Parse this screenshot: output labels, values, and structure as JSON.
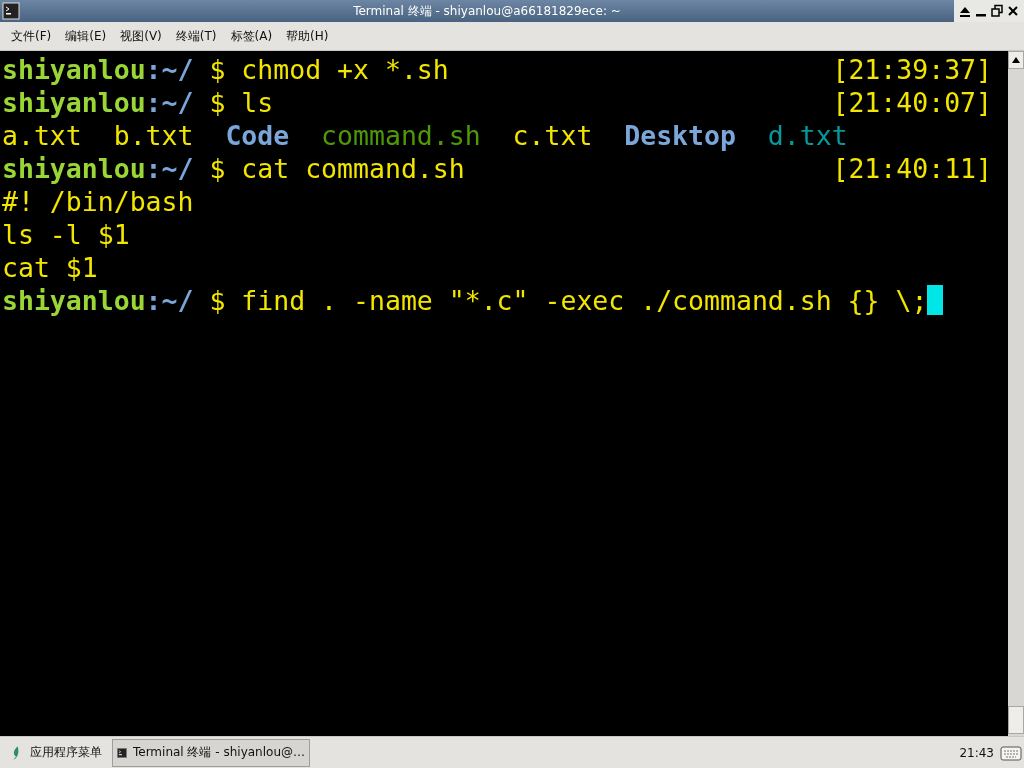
{
  "window": {
    "title": "Terminal 终端 - shiyanlou@a66181829ece: ~"
  },
  "menu": [
    "文件(F)",
    "编辑(E)",
    "视图(V)",
    "终端(T)",
    "标签(A)",
    "帮助(H)"
  ],
  "terminal": {
    "lines": [
      {
        "kind": "prompt",
        "user": "shiyanlou",
        "path": ":~/",
        "sign": "$",
        "command": "chmod +x *.sh",
        "time": "[21:39:37]",
        "cursor": false
      },
      {
        "kind": "prompt",
        "user": "shiyanlou",
        "path": ":~/",
        "sign": "$",
        "command": "ls",
        "time": "[21:40:07]",
        "cursor": false
      },
      {
        "kind": "listing",
        "entries": [
          {
            "text": "a.txt",
            "kind": "file"
          },
          {
            "text": "b.txt",
            "kind": "file"
          },
          {
            "text": "Code",
            "kind": "dir"
          },
          {
            "text": "command.sh",
            "kind": "exec"
          },
          {
            "text": "c.txt",
            "kind": "file"
          },
          {
            "text": "Desktop",
            "kind": "dir"
          },
          {
            "text": "d.txt",
            "kind": "other"
          }
        ]
      },
      {
        "kind": "prompt",
        "user": "shiyanlou",
        "path": ":~/",
        "sign": "$",
        "command": "cat command.sh",
        "time": "[21:40:11]",
        "cursor": false
      },
      {
        "kind": "output",
        "text": "#! /bin/bash"
      },
      {
        "kind": "output",
        "text": "ls -l $1"
      },
      {
        "kind": "output",
        "text": "cat $1"
      },
      {
        "kind": "prompt",
        "user": "shiyanlou",
        "path": ":~/",
        "sign": "$",
        "command": "find . -name \"*.c\" -exec ./command.sh {} \\;",
        "cursor": true
      }
    ]
  },
  "taskbar": {
    "app_menu": "应用程序菜单",
    "tasks": [
      {
        "label": "Terminal 终端 - shiyanlou@…",
        "selected": true
      }
    ],
    "clock": "21:43"
  }
}
